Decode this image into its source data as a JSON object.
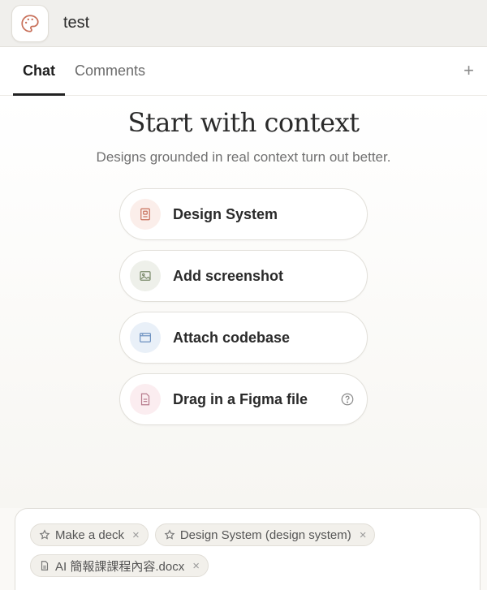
{
  "window": {
    "title": "test"
  },
  "tabs": [
    {
      "label": "Chat",
      "active": true
    },
    {
      "label": "Comments",
      "active": false
    }
  ],
  "tab_add_label": "+",
  "main": {
    "heading": "Start with context",
    "subheading": "Designs grounded in real context turn out better.",
    "options": [
      {
        "label": "Design System",
        "icon": "design-system-icon",
        "bg": "#fbeeea",
        "color": "#c8705a"
      },
      {
        "label": "Add screenshot",
        "icon": "image-icon",
        "bg": "#eef0ea",
        "color": "#7a8a6a"
      },
      {
        "label": "Attach codebase",
        "icon": "code-window-icon",
        "bg": "#e9f0f8",
        "color": "#6b8fbf"
      },
      {
        "label": "Drag in a Figma file",
        "icon": "document-icon",
        "bg": "#fbedf0",
        "color": "#b77a8c",
        "help": true
      }
    ]
  },
  "composer": {
    "chips": [
      {
        "label": "Make a deck",
        "icon": "star-icon"
      },
      {
        "label": "Design System (design system)",
        "icon": "star-icon"
      },
      {
        "label": "AI 簡報課課程內容.docx",
        "icon": "file-icon"
      }
    ],
    "close_glyph": "×"
  },
  "colors": {
    "accent_icon": "#c8705a",
    "tab_underline": "#222222"
  }
}
